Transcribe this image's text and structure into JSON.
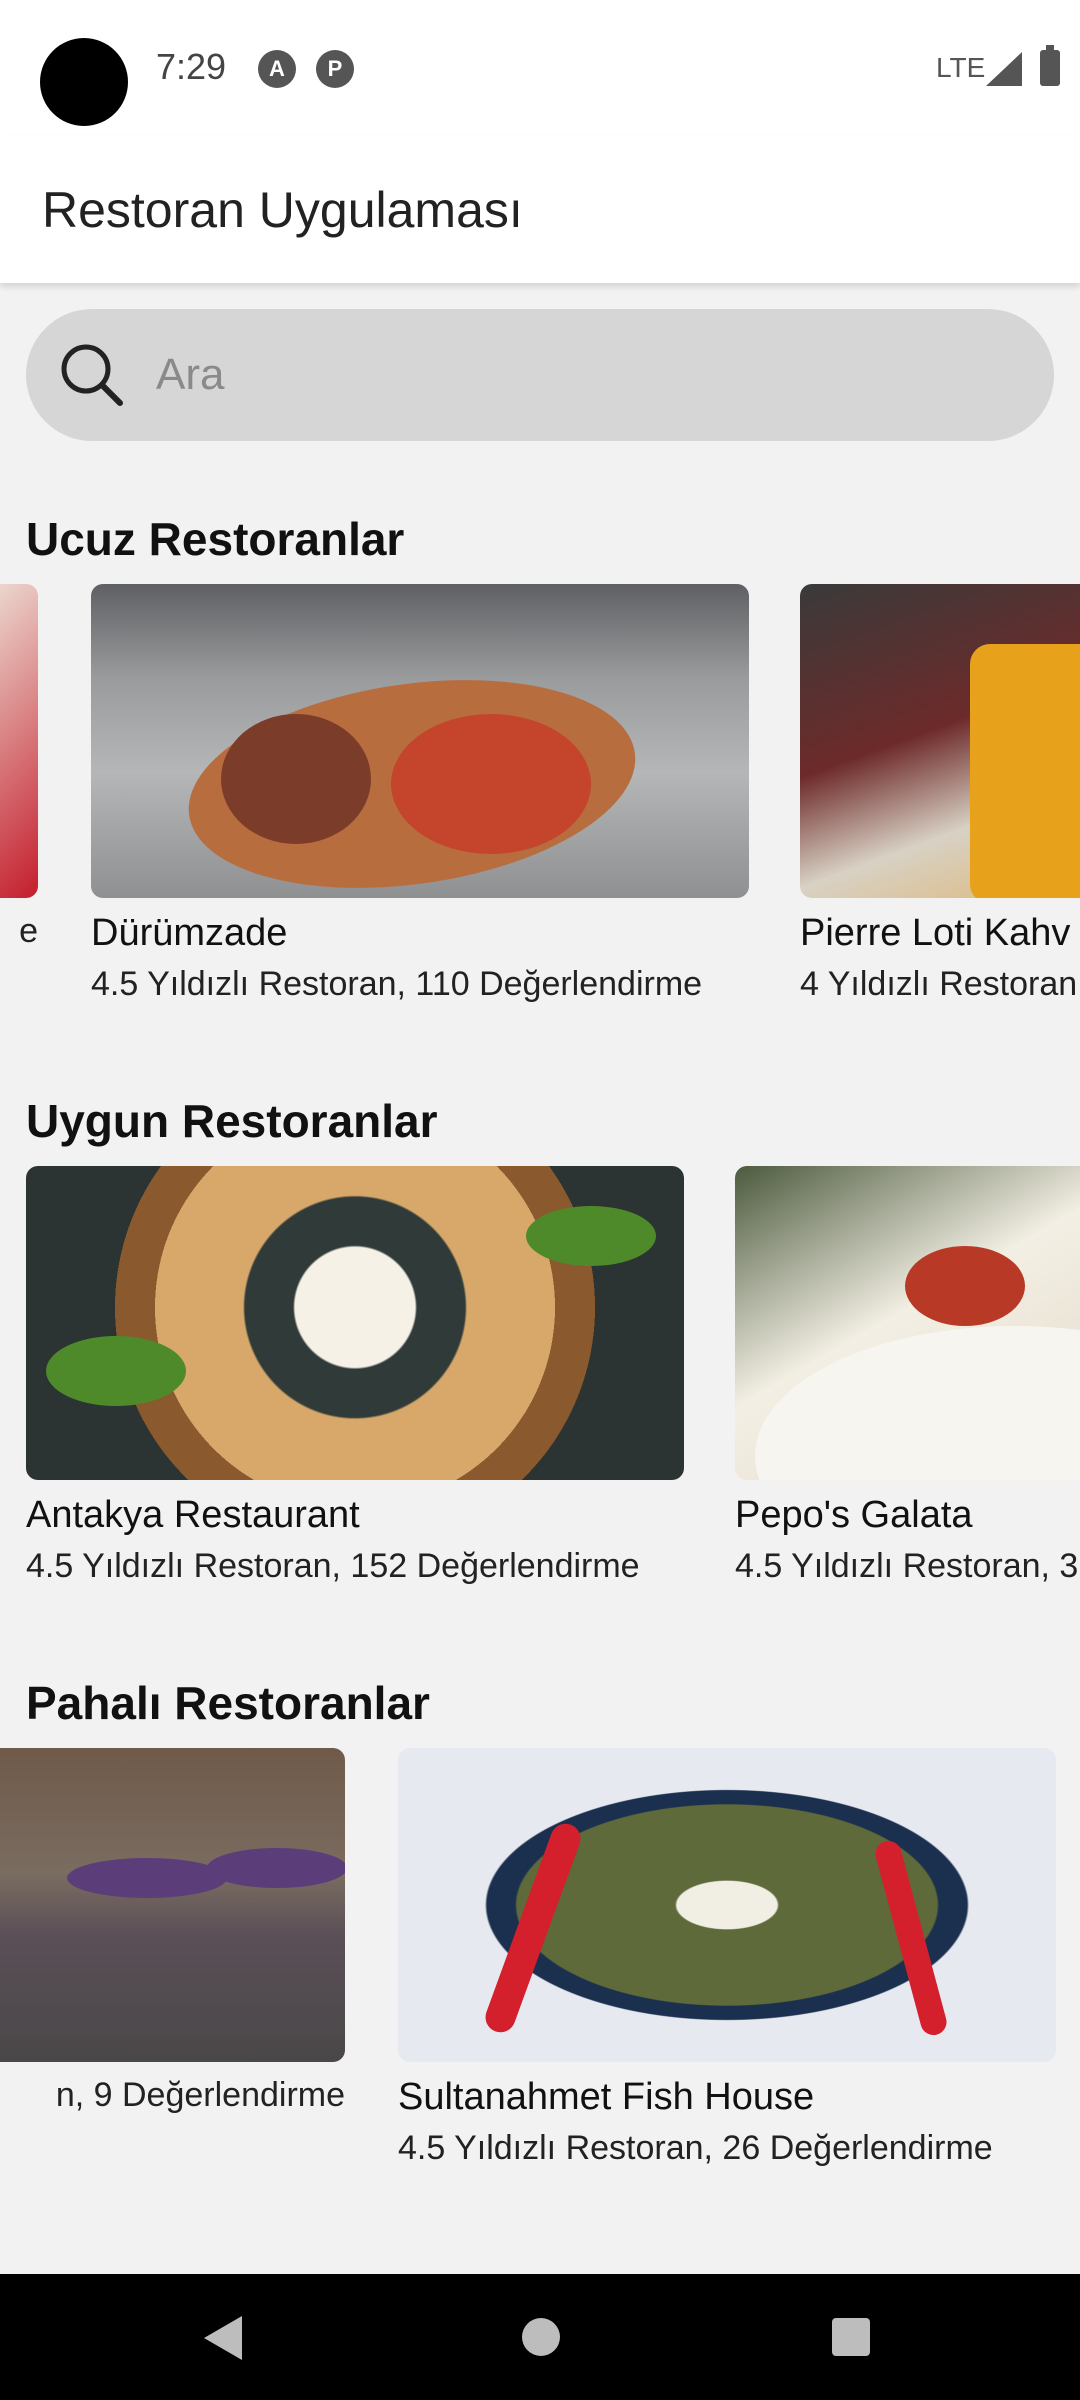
{
  "status_bar": {
    "time": "7:29",
    "network": "LTE",
    "icons": [
      "camera-cutout",
      "a-icon",
      "p-icon",
      "signal-icon",
      "battery-icon"
    ]
  },
  "app_bar": {
    "title": "Restoran Uygulaması"
  },
  "search": {
    "placeholder": "Ara",
    "value": ""
  },
  "sections": [
    {
      "title": "Ucuz Restoranlar",
      "cards": [
        {
          "name": "",
          "meta": "e"
        },
        {
          "name": "Dürümzade",
          "meta": "4.5 Yıldızlı Restoran, 110 Değerlendirme"
        },
        {
          "name": "Pierre Loti Kahv",
          "meta": "4 Yıldızlı Restoran"
        }
      ]
    },
    {
      "title": "Uygun Restoranlar",
      "cards": [
        {
          "name": "Antakya Restaurant",
          "meta": "4.5 Yıldızlı Restoran, 152 Değerlendirme"
        },
        {
          "name": "Pepo's Galata",
          "meta": "4.5 Yıldızlı Restoran, 3"
        }
      ]
    },
    {
      "title": "Pahalı Restoranlar",
      "cards": [
        {
          "name": "",
          "meta": "n, 9 Değerlendirme"
        },
        {
          "name": "Sultanahmet Fish House",
          "meta": "4.5 Yıldızlı Restoran, 26 Değerlendirme"
        }
      ]
    }
  ],
  "colors": {
    "background": "#f2f2f2",
    "app_bar": "#ffffff",
    "search_bg": "#d6d6d6",
    "nav_bar": "#000000"
  }
}
